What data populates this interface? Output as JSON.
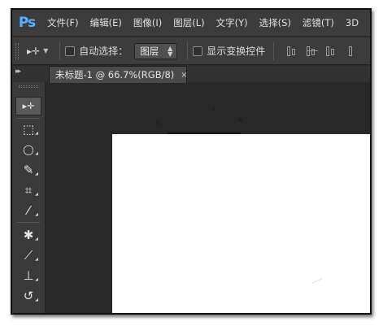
{
  "app": {
    "logo": "Ps"
  },
  "menu": [
    "文件(F)",
    "编辑(E)",
    "图像(I)",
    "图层(L)",
    "文字(Y)",
    "选择(S)",
    "滤镜(T)",
    "3D"
  ],
  "options": {
    "auto_select_label": "自动选择：",
    "auto_select_value": "图层",
    "show_transform_label": "显示变换控件"
  },
  "document": {
    "tab_title": "未标题-1 @ 66.7%(RGB/8)",
    "close_glyph": "×"
  },
  "tools": [
    {
      "name": "move-tool",
      "glyph": "▸✛"
    },
    {
      "name": "rectangular-marquee-tool",
      "glyph": "⬚"
    },
    {
      "name": "lasso-tool",
      "glyph": "◯"
    },
    {
      "name": "quick-selection-tool",
      "glyph": "✎"
    },
    {
      "name": "crop-tool",
      "glyph": "⌗"
    },
    {
      "name": "eyedropper-tool",
      "glyph": "⁄"
    },
    {
      "name": "spot-healing-tool",
      "glyph": "✱"
    },
    {
      "name": "brush-tool",
      "glyph": "⟋"
    },
    {
      "name": "clone-stamp-tool",
      "glyph": "⊥"
    },
    {
      "name": "history-brush-tool",
      "glyph": "↺"
    },
    {
      "name": "eraser-tool",
      "glyph": "▱"
    }
  ],
  "colors": {
    "accent": "#5ab0ff",
    "canvas": "#ffffff",
    "workspace": "#282828"
  }
}
